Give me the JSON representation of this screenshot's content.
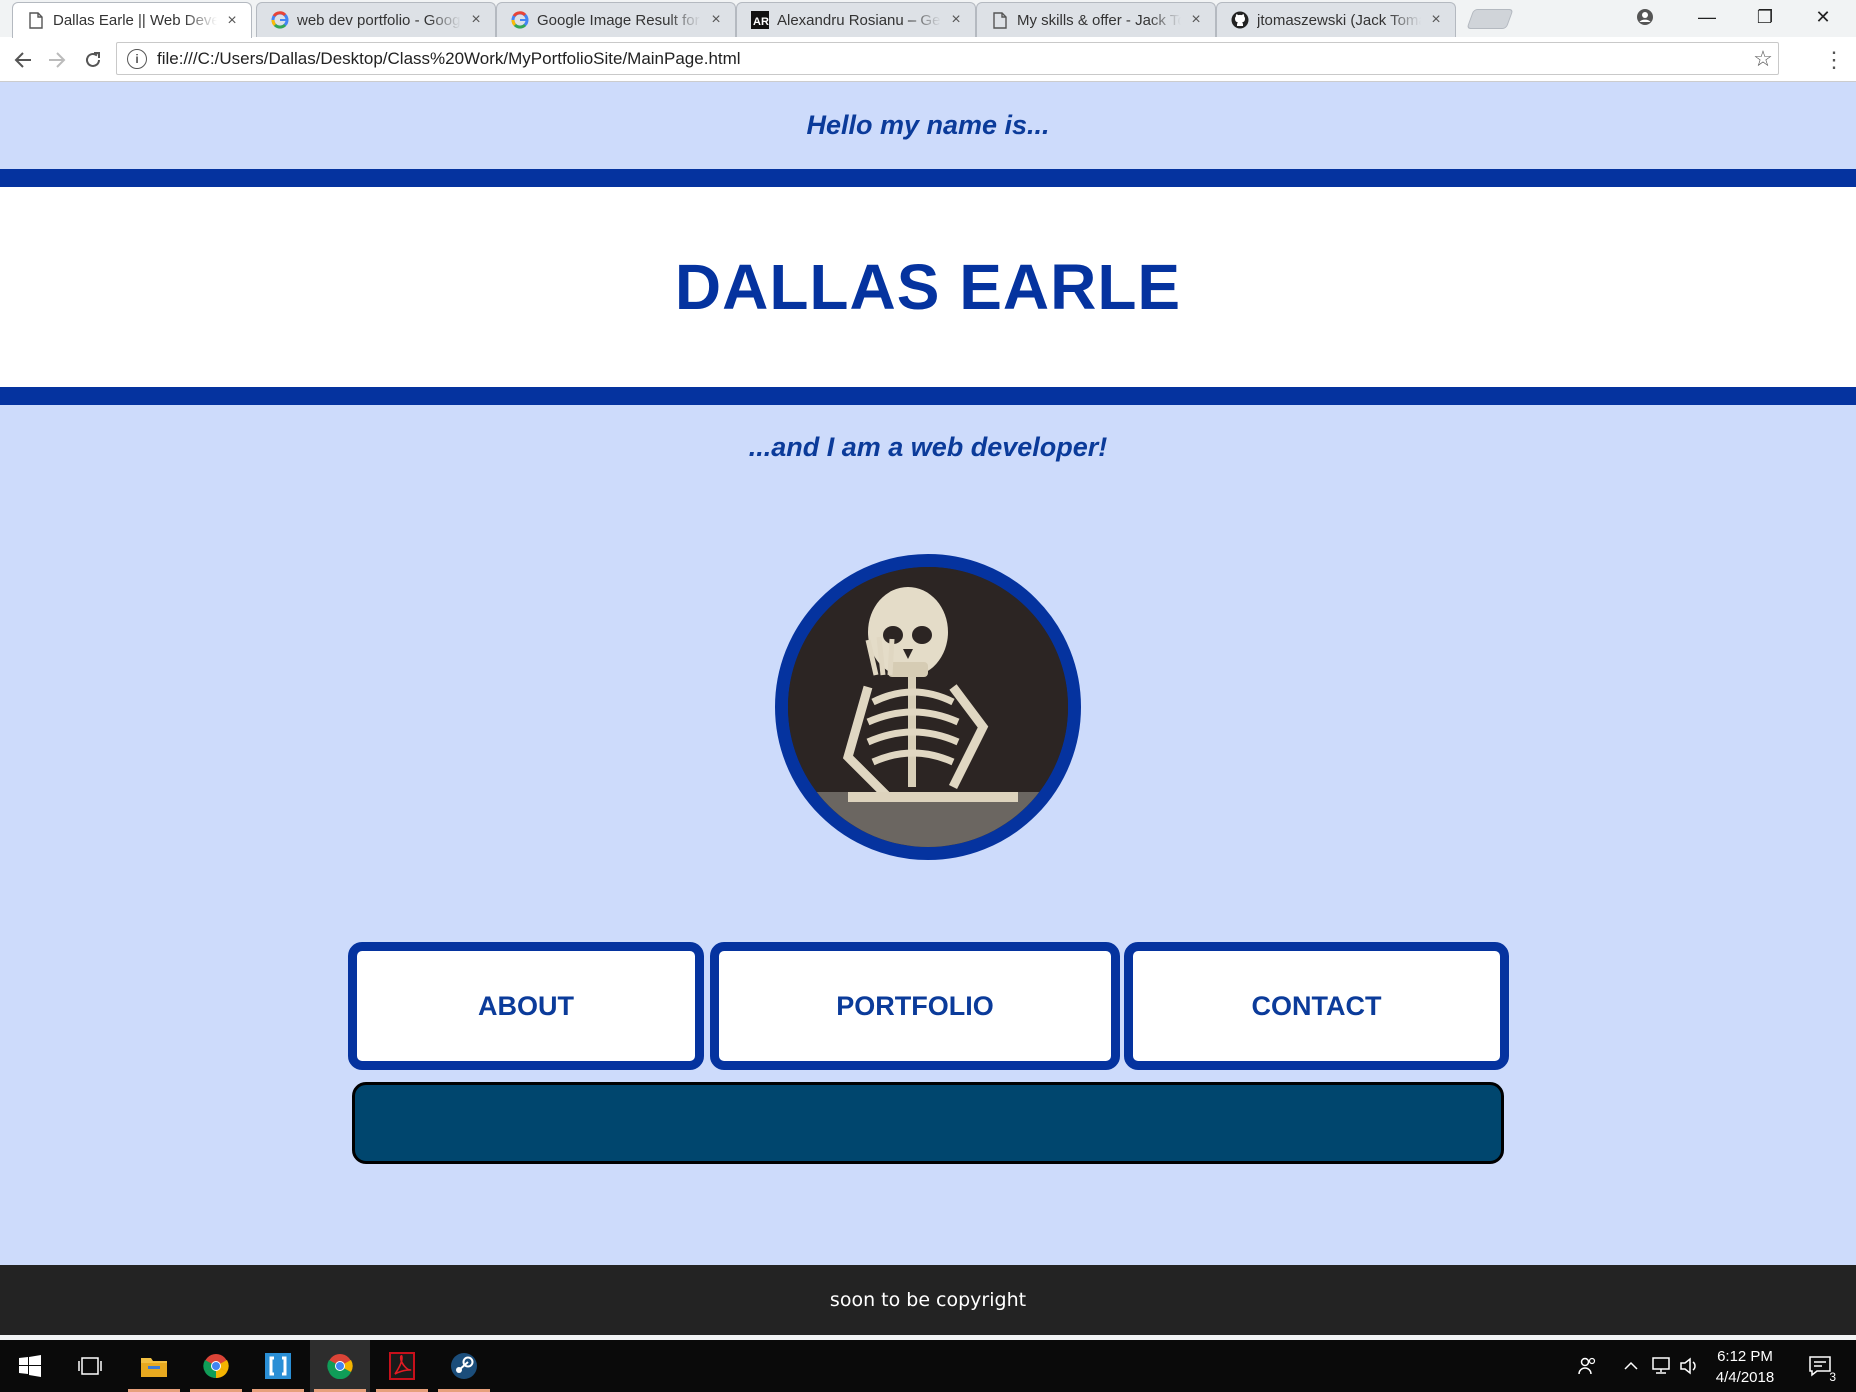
{
  "browser": {
    "tabs": [
      {
        "title": "Dallas Earle || Web Developer",
        "favicon": "page-icon",
        "active": true
      },
      {
        "title": "web dev portfolio - Google Search",
        "favicon": "google-icon",
        "active": false
      },
      {
        "title": "Google Image Result for",
        "favicon": "google-icon",
        "active": false
      },
      {
        "title": "Alexandru Rosianu – Geek",
        "favicon": "ar-icon",
        "active": false
      },
      {
        "title": "My skills & offer - Jack Tomaszewski",
        "favicon": "page-icon",
        "active": false
      },
      {
        "title": "jtomaszewski (Jack Tomaszewski)",
        "favicon": "github-icon",
        "active": false
      }
    ],
    "tab_close_glyph": "×",
    "url": "file:///C:/Users/Dallas/Desktop/Class%20Work/MyPortfolioSite/MainPage.html",
    "window_controls": {
      "minimize": "—",
      "restore": "❐",
      "close": "✕"
    }
  },
  "page": {
    "greeting": "Hello my name is...",
    "name": "DALLAS EARLE",
    "tagline": "...and I am a web developer!",
    "nav": {
      "about": "ABOUT",
      "portfolio": "PORTFOLIO",
      "contact": "CONTACT"
    },
    "footer": "soon to be copyright",
    "colors": {
      "background": "#cddbfb",
      "accent": "#05339f",
      "panel": "#00466e",
      "footer": "#232323"
    }
  },
  "taskbar": {
    "items": [
      "windows-start-icon",
      "task-view-icon",
      "file-explorer-icon",
      "chrome-icon",
      "brackets-icon",
      "chrome-icon",
      "acrobat-icon",
      "steam-icon"
    ],
    "clock_time": "6:12 PM",
    "clock_date": "4/4/2018",
    "notification_count": "3"
  }
}
